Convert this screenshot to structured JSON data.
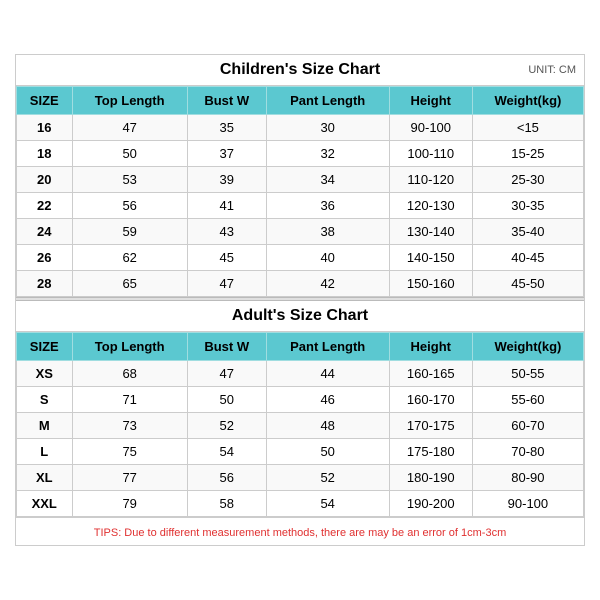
{
  "children_section": {
    "title": "Children's Size Chart",
    "unit": "UNIT: CM",
    "headers": [
      "SIZE",
      "Top Length",
      "Bust W",
      "Pant Length",
      "Height",
      "Weight(kg)"
    ],
    "rows": [
      [
        "16",
        "47",
        "35",
        "30",
        "90-100",
        "<15"
      ],
      [
        "18",
        "50",
        "37",
        "32",
        "100-110",
        "15-25"
      ],
      [
        "20",
        "53",
        "39",
        "34",
        "110-120",
        "25-30"
      ],
      [
        "22",
        "56",
        "41",
        "36",
        "120-130",
        "30-35"
      ],
      [
        "24",
        "59",
        "43",
        "38",
        "130-140",
        "35-40"
      ],
      [
        "26",
        "62",
        "45",
        "40",
        "140-150",
        "40-45"
      ],
      [
        "28",
        "65",
        "47",
        "42",
        "150-160",
        "45-50"
      ]
    ]
  },
  "adult_section": {
    "title": "Adult's Size Chart",
    "headers": [
      "SIZE",
      "Top Length",
      "Bust W",
      "Pant Length",
      "Height",
      "Weight(kg)"
    ],
    "rows": [
      [
        "XS",
        "68",
        "47",
        "44",
        "160-165",
        "50-55"
      ],
      [
        "S",
        "71",
        "50",
        "46",
        "160-170",
        "55-60"
      ],
      [
        "M",
        "73",
        "52",
        "48",
        "170-175",
        "60-70"
      ],
      [
        "L",
        "75",
        "54",
        "50",
        "175-180",
        "70-80"
      ],
      [
        "XL",
        "77",
        "56",
        "52",
        "180-190",
        "80-90"
      ],
      [
        "XXL",
        "79",
        "58",
        "54",
        "190-200",
        "90-100"
      ]
    ]
  },
  "tips": "TIPS: Due to different measurement methods, there are may be an error of 1cm-3cm"
}
